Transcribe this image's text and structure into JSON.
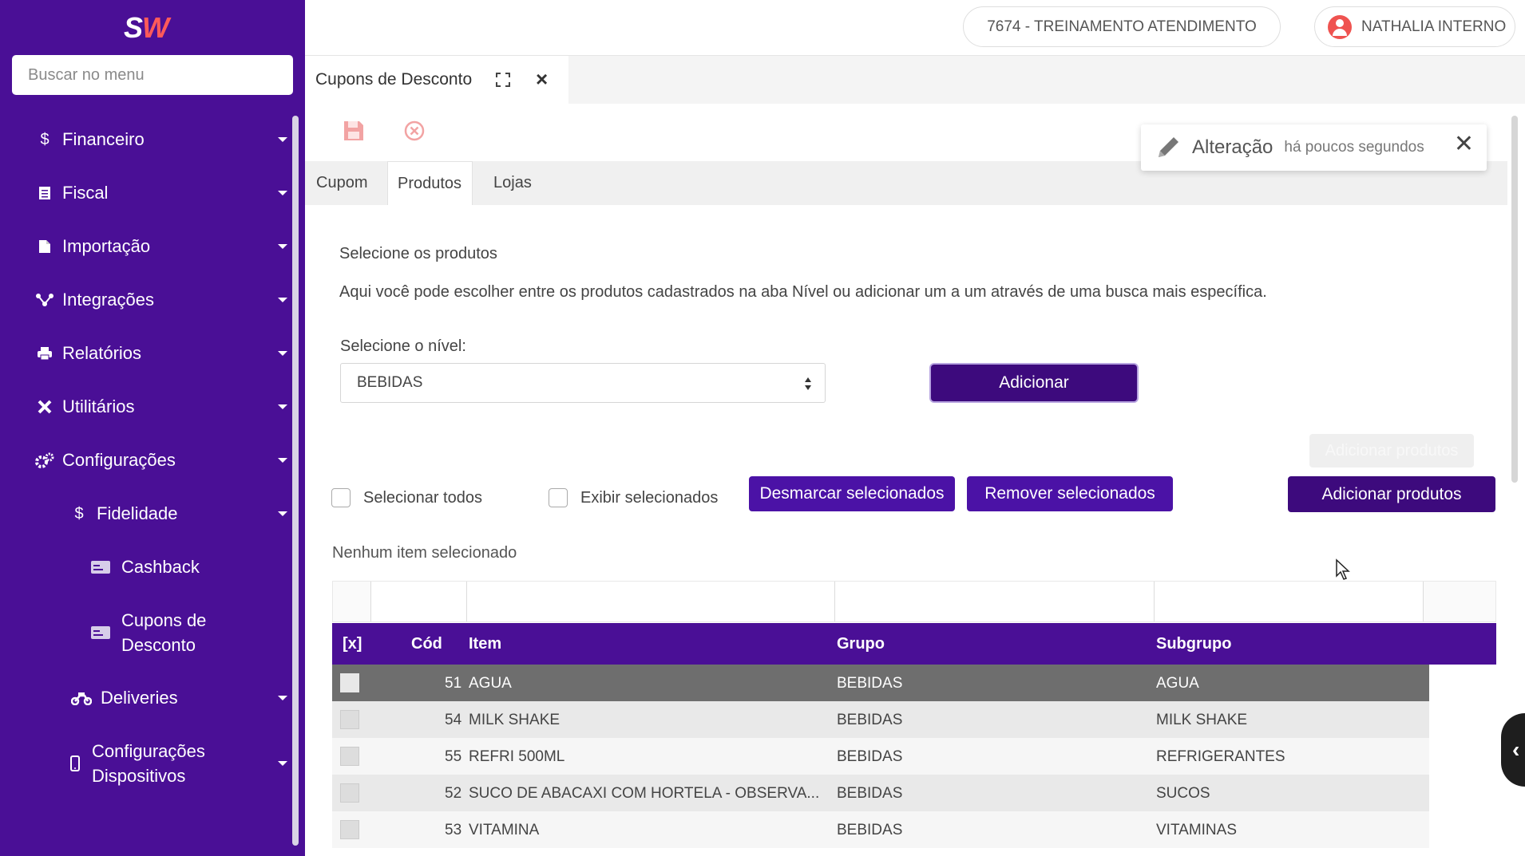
{
  "app": {
    "logo": "SW",
    "colors": {
      "sidebar": "#4a0f96",
      "primary_button": "#3d0a7d",
      "accent": "#ef5350"
    }
  },
  "sidebar": {
    "search_placeholder": "Buscar no menu",
    "items": [
      {
        "label": "Financeiro",
        "icon": "dollar-icon"
      },
      {
        "label": "Fiscal",
        "icon": "document-icon"
      },
      {
        "label": "Importação",
        "icon": "file-icon"
      },
      {
        "label": "Integrações",
        "icon": "network-icon"
      },
      {
        "label": "Relatórios",
        "icon": "printer-icon"
      },
      {
        "label": "Utilitários",
        "icon": "tools-icon"
      },
      {
        "label": "Configurações",
        "icon": "gears-icon"
      },
      {
        "label": "Fidelidade",
        "icon": "dollar-icon"
      },
      {
        "label": "Cashback",
        "icon": "card-icon"
      },
      {
        "label_line1": "Cupons de",
        "label_line2": "Desconto",
        "icon": "card-icon"
      },
      {
        "label": "Deliveries",
        "icon": "motorcycle-icon"
      },
      {
        "label_line1": "Configurações",
        "label_line2": "Dispositivos",
        "icon": "mobile-icon"
      }
    ]
  },
  "header": {
    "company": "7674 - TREINAMENTO ATENDIMENTO",
    "user": "NATHALIA INTERNO"
  },
  "tab": {
    "title": "Cupons de Desconto"
  },
  "notification": {
    "title": "Alteração",
    "time": "há poucos segundos"
  },
  "subtabs": [
    "Cupom",
    "Produtos",
    "Lojas"
  ],
  "products": {
    "section_title": "Selecione os produtos",
    "description": "Aqui você pode escolher entre os produtos cadastrados na aba Nível ou adicionar um a um através de uma busca mais específica.",
    "level_label": "Selecione o nível:",
    "level_value": "BEBIDAS",
    "add_button": "Adicionar",
    "ghost_button": "Adicionar produtos",
    "select_all": "Selecionar todos",
    "show_selected": "Exibir selecionados",
    "unmark_button": "Desmarcar selecionados",
    "remove_button": "Remover selecionados",
    "add_products_button": "Adicionar produtos",
    "status": "Nenhum item selecionado"
  },
  "table": {
    "headers": {
      "check": "[x]",
      "code": "Cód",
      "item": "Item",
      "group": "Grupo",
      "subgroup": "Subgrupo"
    },
    "rows": [
      {
        "code": "51",
        "item": "AGUA",
        "group": "BEBIDAS",
        "subgroup": "AGUA"
      },
      {
        "code": "54",
        "item": "MILK SHAKE",
        "group": "BEBIDAS",
        "subgroup": "MILK SHAKE"
      },
      {
        "code": "55",
        "item": "REFRI 500ML",
        "group": "BEBIDAS",
        "subgroup": "REFRIGERANTES"
      },
      {
        "code": "52",
        "item": "SUCO DE ABACAXI COM HORTELA - OBSERVA...",
        "group": "BEBIDAS",
        "subgroup": "SUCOS"
      },
      {
        "code": "53",
        "item": "VITAMINA",
        "group": "BEBIDAS",
        "subgroup": "VITAMINAS"
      }
    ]
  }
}
